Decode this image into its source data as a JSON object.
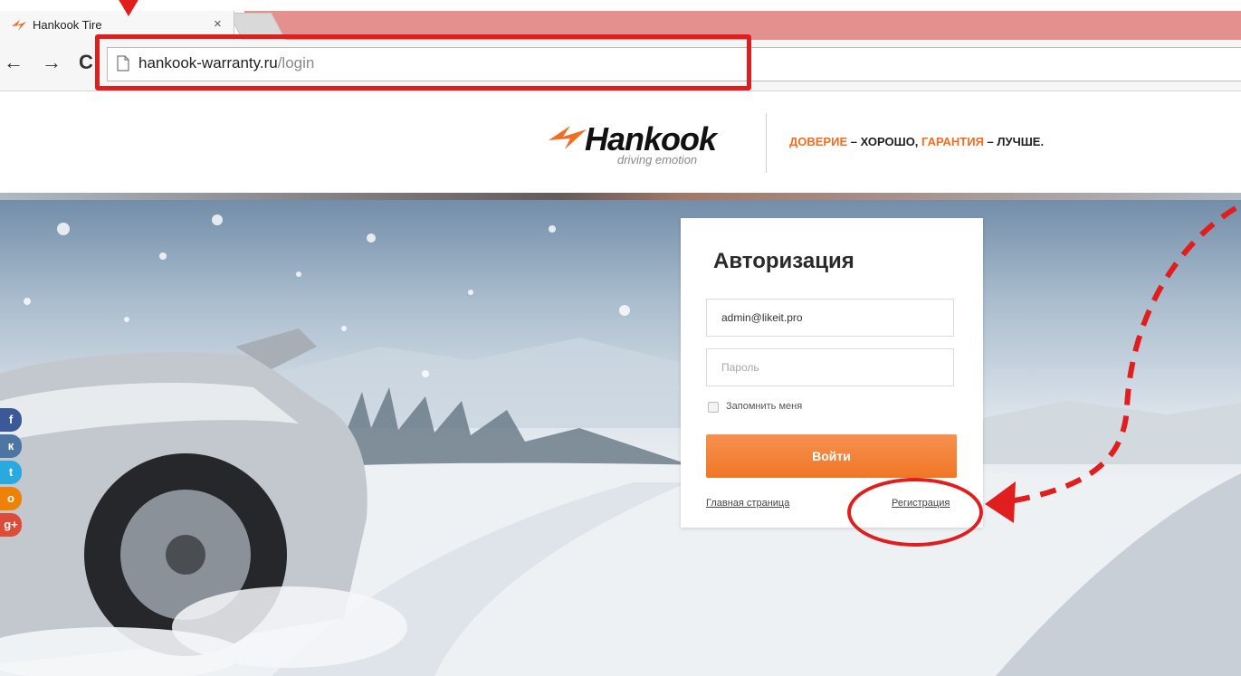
{
  "browser": {
    "tab_title": "Hankook Tire",
    "tab_close": "×",
    "back": "←",
    "forward": "→",
    "reload": "C",
    "url_host": "hankook-warranty.ru",
    "url_path": "/login"
  },
  "header": {
    "logo_word": "Hankook",
    "logo_tagline": "driving emotion",
    "slogan_part1": "ДОВЕРИЕ",
    "slogan_part2": " – ХОРОШО, ",
    "slogan_part3": "ГАРАНТИЯ",
    "slogan_part4": " – ЛУЧШЕ."
  },
  "social": [
    {
      "icon": "facebook-icon",
      "glyph": "f",
      "color": "#3b5998"
    },
    {
      "icon": "vk-icon",
      "glyph": "к",
      "color": "#4c75a3"
    },
    {
      "icon": "twitter-icon",
      "glyph": "t",
      "color": "#2aa9e0"
    },
    {
      "icon": "odnoklassniki-icon",
      "glyph": "о",
      "color": "#ee8208"
    },
    {
      "icon": "google-plus-icon",
      "glyph": "g+",
      "color": "#dd4b39"
    }
  ],
  "login": {
    "title": "Авторизация",
    "email_value": "admin@likeit.pro",
    "password_placeholder": "Пароль",
    "remember_label": "Запомнить меня",
    "submit_label": "Войти",
    "home_link": "Главная страница",
    "register_link": "Регистрация"
  },
  "colors": {
    "accent": "#f07627",
    "annotation_red": "#e01e1e",
    "tabstrip": "#e3908e"
  }
}
